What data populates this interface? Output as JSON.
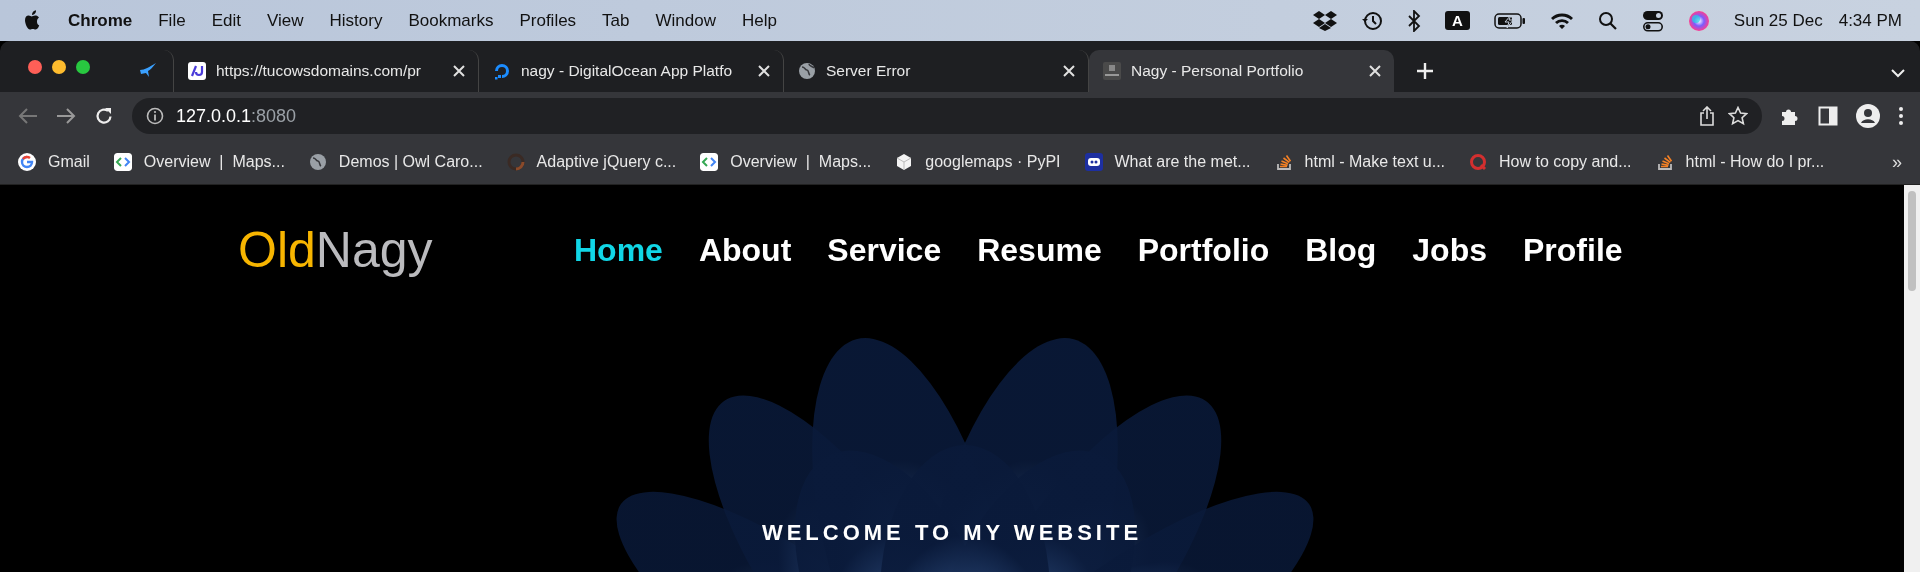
{
  "menu_bar": {
    "app": "Chrome",
    "items": [
      "File",
      "Edit",
      "View",
      "History",
      "Bookmarks",
      "Profiles",
      "Tab",
      "Window",
      "Help"
    ],
    "input_source": "A",
    "date": "Sun 25 Dec",
    "time": "4:34 PM"
  },
  "tabs": [
    {
      "kind": "pinned",
      "selected": false
    },
    {
      "kind": "normal",
      "title": "https://tucowsdomains.com/pr",
      "selected": false
    },
    {
      "kind": "normal",
      "title": "nagy - DigitalOcean App Platfo",
      "selected": false
    },
    {
      "kind": "normal",
      "title": "Server Error",
      "selected": false
    },
    {
      "kind": "normal",
      "title": "Nagy - Personal Portfolio",
      "selected": true
    }
  ],
  "address_bar": {
    "host": "127.0.0.1",
    "port": ":8080"
  },
  "bookmarks": [
    "Gmail",
    "Overview  |  Maps...",
    "Demos | Owl Caro...",
    "Adaptive jQuery c...",
    "Overview  |  Maps...",
    "googlemaps · PyPI",
    "What are the met...",
    "html - Make text u...",
    "How to copy and...",
    "html - How do I pr..."
  ],
  "bookmarks_overflow": "»",
  "page": {
    "logo": [
      "Old",
      "Nagy"
    ],
    "nav": [
      {
        "label": "Home",
        "selected": true
      },
      {
        "label": "About",
        "selected": false
      },
      {
        "label": "Service",
        "selected": false
      },
      {
        "label": "Resume",
        "selected": false
      },
      {
        "label": "Portfolio",
        "selected": false
      },
      {
        "label": "Blog",
        "selected": false
      },
      {
        "label": "Jobs",
        "selected": false
      },
      {
        "label": "Profile",
        "selected": false
      }
    ],
    "welcome": "WELCOME TO MY WEBSITE"
  }
}
